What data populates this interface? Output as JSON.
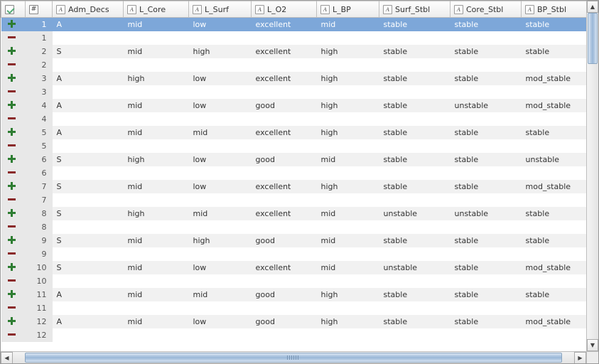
{
  "columns": [
    "Adm_Decs",
    "L_Core",
    "L_Surf",
    "L_O2",
    "L_BP",
    "Surf_Stbl",
    "Core_Stbl",
    "BP_Stbl"
  ],
  "rows": [
    {
      "n": 1,
      "icon": "plus",
      "vals": [
        "A",
        "mid",
        "low",
        "excellent",
        "mid",
        "stable",
        "stable",
        "stable"
      ],
      "sel": true
    },
    {
      "n": 1,
      "icon": "minus",
      "vals": [
        "",
        "",
        "",
        "",
        "",
        "",
        "",
        ""
      ]
    },
    {
      "n": 2,
      "icon": "plus",
      "vals": [
        "S",
        "mid",
        "high",
        "excellent",
        "high",
        "stable",
        "stable",
        "stable"
      ]
    },
    {
      "n": 2,
      "icon": "minus",
      "vals": [
        "",
        "",
        "",
        "",
        "",
        "",
        "",
        ""
      ]
    },
    {
      "n": 3,
      "icon": "plus",
      "vals": [
        "A",
        "high",
        "low",
        "excellent",
        "high",
        "stable",
        "stable",
        "mod_stable"
      ]
    },
    {
      "n": 3,
      "icon": "minus",
      "vals": [
        "",
        "",
        "",
        "",
        "",
        "",
        "",
        ""
      ]
    },
    {
      "n": 4,
      "icon": "plus",
      "vals": [
        "A",
        "mid",
        "low",
        "good",
        "high",
        "stable",
        "unstable",
        "mod_stable"
      ]
    },
    {
      "n": 4,
      "icon": "minus",
      "vals": [
        "",
        "",
        "",
        "",
        "",
        "",
        "",
        ""
      ]
    },
    {
      "n": 5,
      "icon": "plus",
      "vals": [
        "A",
        "mid",
        "mid",
        "excellent",
        "high",
        "stable",
        "stable",
        "stable"
      ]
    },
    {
      "n": 5,
      "icon": "minus",
      "vals": [
        "",
        "",
        "",
        "",
        "",
        "",
        "",
        ""
      ]
    },
    {
      "n": 6,
      "icon": "plus",
      "vals": [
        "S",
        "high",
        "low",
        "good",
        "mid",
        "stable",
        "stable",
        "unstable"
      ]
    },
    {
      "n": 6,
      "icon": "minus",
      "vals": [
        "",
        "",
        "",
        "",
        "",
        "",
        "",
        ""
      ]
    },
    {
      "n": 7,
      "icon": "plus",
      "vals": [
        "S",
        "mid",
        "low",
        "excellent",
        "high",
        "stable",
        "stable",
        "mod_stable"
      ]
    },
    {
      "n": 7,
      "icon": "minus",
      "vals": [
        "",
        "",
        "",
        "",
        "",
        "",
        "",
        ""
      ]
    },
    {
      "n": 8,
      "icon": "plus",
      "vals": [
        "S",
        "high",
        "mid",
        "excellent",
        "mid",
        "unstable",
        "unstable",
        "stable"
      ]
    },
    {
      "n": 8,
      "icon": "minus",
      "vals": [
        "",
        "",
        "",
        "",
        "",
        "",
        "",
        ""
      ]
    },
    {
      "n": 9,
      "icon": "plus",
      "vals": [
        "S",
        "mid",
        "high",
        "good",
        "mid",
        "stable",
        "stable",
        "stable"
      ]
    },
    {
      "n": 9,
      "icon": "minus",
      "vals": [
        "",
        "",
        "",
        "",
        "",
        "",
        "",
        ""
      ]
    },
    {
      "n": 10,
      "icon": "plus",
      "vals": [
        "S",
        "mid",
        "low",
        "excellent",
        "mid",
        "unstable",
        "stable",
        "mod_stable"
      ]
    },
    {
      "n": 10,
      "icon": "minus",
      "vals": [
        "",
        "",
        "",
        "",
        "",
        "",
        "",
        ""
      ]
    },
    {
      "n": 11,
      "icon": "plus",
      "vals": [
        "A",
        "mid",
        "mid",
        "good",
        "high",
        "stable",
        "stable",
        "stable"
      ]
    },
    {
      "n": 11,
      "icon": "minus",
      "vals": [
        "",
        "",
        "",
        "",
        "",
        "",
        "",
        ""
      ]
    },
    {
      "n": 12,
      "icon": "plus",
      "vals": [
        "A",
        "mid",
        "low",
        "good",
        "high",
        "stable",
        "stable",
        "mod_stable"
      ]
    },
    {
      "n": 12,
      "icon": "minus",
      "vals": [
        "",
        "",
        "",
        "",
        "",
        "",
        "",
        ""
      ]
    }
  ]
}
